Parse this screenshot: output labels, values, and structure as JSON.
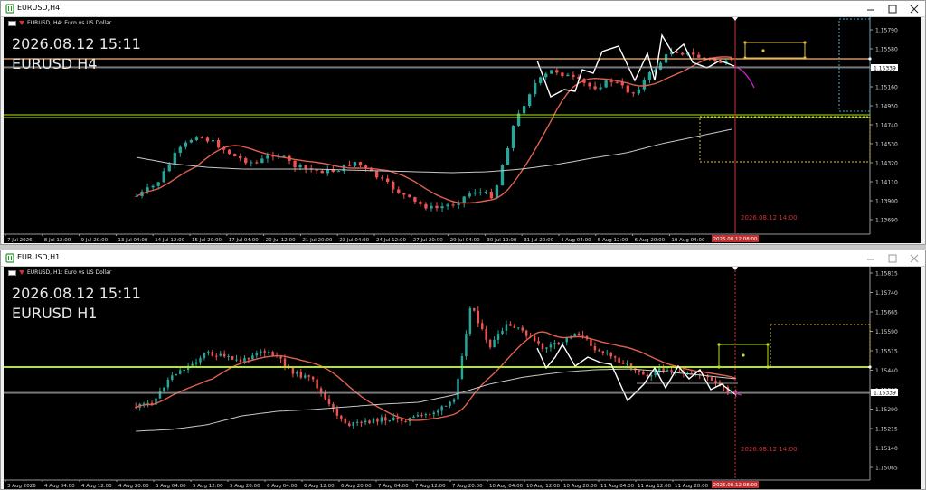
{
  "top": {
    "title": "EURUSD,H4",
    "header": "EURUSD, H4:  Euro vs US Dollar",
    "overlay_time": "2026.08.12 15:11",
    "overlay_symbol": "EURUSD H4",
    "price_ticks": [
      "1.15790",
      "1.15580",
      "1.15339",
      "1.15160",
      "1.14950",
      "1.14740",
      "1.14530",
      "1.14320",
      "1.14110",
      "1.13900",
      "1.13690"
    ],
    "current_price": "1.15339",
    "time_ticks": [
      "7 Jul 2026",
      "8 Jul 12:00",
      "9 Jul 20:00",
      "13 Jul 04:00",
      "14 Jul 12:00",
      "15 Jul 20:00",
      "17 Jul 04:00",
      "20 Jul 12:00",
      "21 Jul 20:00",
      "23 Jul 04:00",
      "24 Jul 12:00",
      "27 Jul 20:00",
      "29 Jul 04:00",
      "30 Jul 12:00",
      "31 Jul 20:00",
      "4 Aug 04:00",
      "5 Aug 12:00",
      "6 Aug 20:00",
      "10 Aug 04:00"
    ],
    "highlighted_time": "2026.08.12 08:00",
    "vline_label": "2026.08.12 14:00"
  },
  "bottom": {
    "title": "EURUSD,H1",
    "header": "EURUSD, H1:  Euro vs US Dollar",
    "overlay_time": "2026.08.12 15:11",
    "overlay_symbol": "EURUSD H1",
    "price_ticks": [
      "1.15815",
      "1.15740",
      "1.15665",
      "1.15590",
      "1.15515",
      "1.15440",
      "1.15365",
      "1.15290",
      "1.15215",
      "1.15140",
      "1.15065"
    ],
    "current_price": "1.15339",
    "time_ticks": [
      "3 Aug 2026",
      "4 Aug 04:00",
      "4 Aug 12:00",
      "4 Aug 20:00",
      "5 Aug 04:00",
      "5 Aug 12:00",
      "5 Aug 20:00",
      "6 Aug 04:00",
      "6 Aug 12:00",
      "6 Aug 20:00",
      "7 Aug 04:00",
      "7 Aug 12:00",
      "7 Aug 20:00",
      "10 Aug 04:00",
      "10 Aug 12:00",
      "10 Aug 20:00",
      "11 Aug 04:00",
      "11 Aug 12:00",
      "11 Aug 20:00"
    ],
    "highlighted_time": "2026.08.12 08:00",
    "vline_label": "2026.08.12 14:00"
  },
  "colors": {
    "bull": "#26a69a",
    "bear": "#ef5350",
    "ma_fast": "#e06050",
    "ma_slow": "#c8c8c8",
    "level_orange": "#f5b070",
    "level_green": "#b5e61d",
    "vline": "#d03030",
    "zigzag": "#ffffff",
    "projection": "#c020c0",
    "box_yellow": "#e0c040",
    "box_cyan": "#40b0d0"
  }
}
